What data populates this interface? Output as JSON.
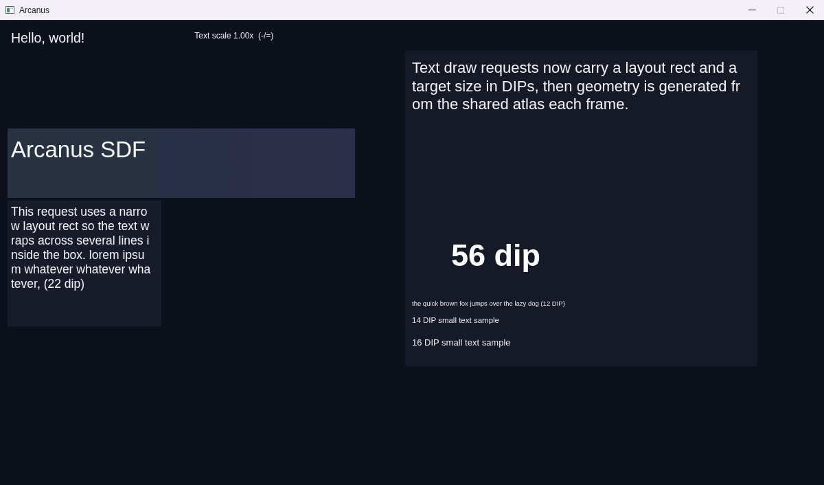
{
  "window": {
    "title": "Arcanus",
    "controls": [
      {
        "kind": "minimize",
        "disabled": false
      },
      {
        "kind": "maximize",
        "disabled": true
      },
      {
        "kind": "close",
        "disabled": false
      }
    ]
  },
  "left": {
    "greeting": "Hello, world!",
    "scale_label": "Text scale 1.00x  (-/=)",
    "banner": {
      "title": "Arcanus SDF"
    },
    "narrow_box": {
      "lines": [
        "This request uses a narro",
        "w layout rect so the text w",
        "raps across several lines i",
        "nside the box. lorem ipsu",
        "m whatever whatever wha",
        "tever, (22 dip)"
      ]
    }
  },
  "right_panel": {
    "paragraph_lines": [
      "Text draw requests now carry a layout rect and a",
      "target size in DIPs, then geometry is generated fr",
      "om the shared atlas each frame."
    ],
    "large_sample": "56 dip",
    "samples": [
      "the quick brown fox jumps over the lazy dog (12 DIP)",
      "14 DIP small text sample",
      "16 DIP small text sample"
    ]
  }
}
